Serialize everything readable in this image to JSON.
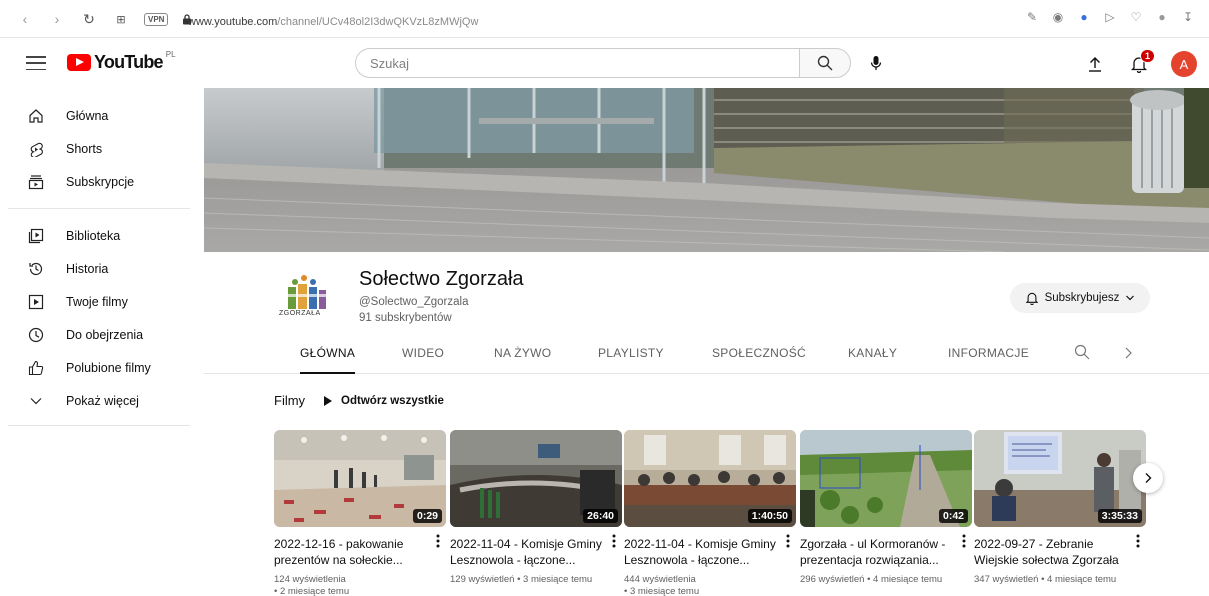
{
  "browser": {
    "url_host": "www.youtube.com",
    "url_path": "/channel/UCv48ol2I3dwQKVzL8zMWjQw",
    "vpn_label": "VPN"
  },
  "header": {
    "logo_text": "YouTube",
    "region": "PL",
    "search_placeholder": "Szukaj",
    "notification_count": "1",
    "avatar_letter": "A",
    "avatar_color": "#e4432e"
  },
  "sidebar": {
    "items": [
      {
        "label": "Główna",
        "icon": "home-icon"
      },
      {
        "label": "Shorts",
        "icon": "shorts-icon"
      },
      {
        "label": "Subskrypcje",
        "icon": "subscriptions-icon"
      },
      {
        "label": "Biblioteka",
        "icon": "library-icon"
      },
      {
        "label": "Historia",
        "icon": "history-icon"
      },
      {
        "label": "Twoje filmy",
        "icon": "your-videos-icon"
      },
      {
        "label": "Do obejrzenia",
        "icon": "watch-later-icon"
      },
      {
        "label": "Polubione filmy",
        "icon": "liked-icon"
      },
      {
        "label": "Pokaż więcej",
        "icon": "chevron-down-icon"
      }
    ]
  },
  "channel": {
    "title": "Sołectwo Zgorzała",
    "handle": "@Solectwo_Zgorzala",
    "subscribers": "91 subskrybentów",
    "logo_caption": "ZGORZAŁA",
    "subscribe_label": "Subskrybujesz",
    "tabs": [
      "GŁÓWNA",
      "WIDEO",
      "NA ŻYWO",
      "PLAYLISTY",
      "SPOŁECZNOŚĆ",
      "KANAŁY",
      "INFORMACJE"
    ],
    "active_tab": "GŁÓWNA"
  },
  "section": {
    "title": "Filmy",
    "play_all": "Odtwórz wszystkie"
  },
  "videos": [
    {
      "title_line1": "2022-12-16 - pakowanie",
      "title_line2": "prezentów na sołeckie...",
      "duration": "0:29",
      "views": "124 wyświetlenia",
      "age": "• 2 miesiące temu"
    },
    {
      "title_line1": "2022-11-04 - Komisje Gminy",
      "title_line2": "Lesznowola - łączone...",
      "duration": "26:40",
      "views": "129 wyświetleń",
      "age": "• 3 miesiące temu"
    },
    {
      "title_line1": "2022-11-04 - Komisje Gminy",
      "title_line2": "Lesznowola - łączone...",
      "duration": "1:40:50",
      "views": "444 wyświetlenia",
      "age": "• 3 miesiące temu"
    },
    {
      "title_line1": "Zgorzała - ul Kormoranów -",
      "title_line2": "prezentacja rozwiązania...",
      "duration": "0:42",
      "views": "296 wyświetleń",
      "age": "• 4 miesiące temu"
    },
    {
      "title_line1": "2022-09-27 - Zebranie",
      "title_line2": "Wiejskie sołectwa Zgorzała",
      "duration": "3:35:33",
      "views": "347 wyświetleń",
      "age": "• 4 miesiące temu"
    }
  ]
}
